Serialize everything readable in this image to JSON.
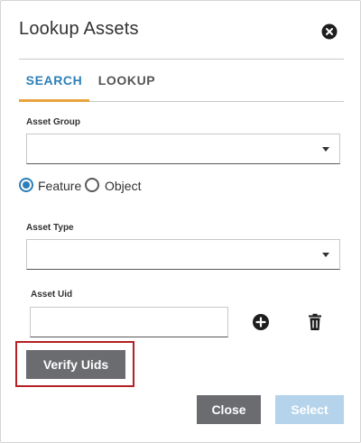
{
  "dialog": {
    "title": "Lookup Assets"
  },
  "tabs": [
    {
      "label": "SEARCH",
      "active": true
    },
    {
      "label": "LOOKUP",
      "active": false
    }
  ],
  "fields": {
    "asset_group": {
      "label": "Asset Group",
      "value": ""
    },
    "asset_type": {
      "label": "Asset Type",
      "value": ""
    },
    "asset_uid": {
      "label": "Asset Uid",
      "value": ""
    }
  },
  "radio_options": [
    {
      "label": "Feature",
      "checked": true
    },
    {
      "label": "Object",
      "checked": false
    }
  ],
  "buttons": {
    "verify": "Verify Uids",
    "close": "Close",
    "select": "Select"
  },
  "icons": {
    "close": "close-circle-icon",
    "add": "plus-circle-icon",
    "delete": "trash-icon",
    "dropdown": "chevron-down-icon"
  },
  "colors": {
    "accent": "#2c7fb8",
    "tab_indicator": "#e8a33d",
    "button_dark": "#6a6c70",
    "button_disabled": "#b5d3ea",
    "highlight": "#b52025"
  }
}
